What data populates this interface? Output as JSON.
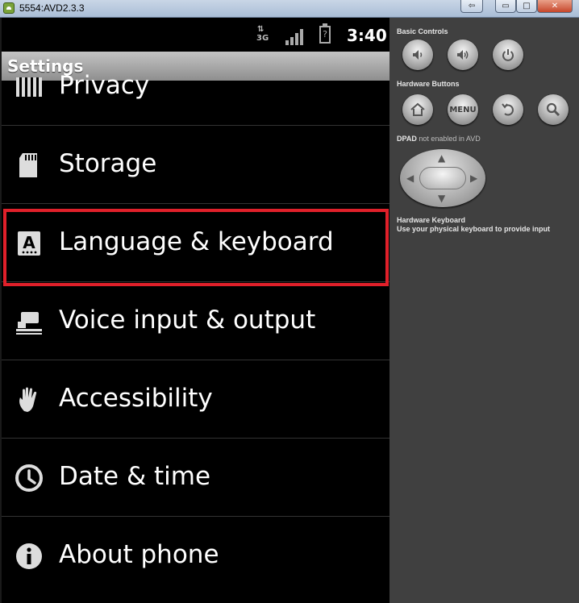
{
  "window": {
    "title": "5554:AVD2.3.3",
    "back_icon": "⇦",
    "min_icon": "▭",
    "max_icon": "□",
    "close_icon": "✕"
  },
  "statusbar": {
    "network": "3G",
    "network_arrows": "⇅",
    "battery": "?",
    "time": "3:40"
  },
  "header": {
    "title": "Settings"
  },
  "settings_items": [
    {
      "label": "Privacy",
      "icon": "privacy-icon"
    },
    {
      "label": "Storage",
      "icon": "sd-card-icon"
    },
    {
      "label": "Language & keyboard",
      "icon": "language-icon"
    },
    {
      "label": "Voice input & output",
      "icon": "voice-icon"
    },
    {
      "label": "Accessibility",
      "icon": "hand-icon"
    },
    {
      "label": "Date & time",
      "icon": "clock-icon"
    },
    {
      "label": "About phone",
      "icon": "info-icon"
    }
  ],
  "highlighted_item": "Language & keyboard",
  "highlight_color": "#e0202a",
  "panel": {
    "basic_controls": "Basic Controls",
    "hardware_buttons": "Hardware Buttons",
    "menu_label": "MENU",
    "dpad_label": "DPAD",
    "dpad_status": "not enabled in AVD",
    "hardware_keyboard": "Hardware Keyboard",
    "hardware_keyboard_desc": "Use your physical keyboard to provide input"
  }
}
